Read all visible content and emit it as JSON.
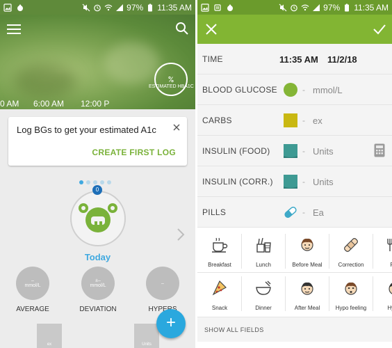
{
  "left": {
    "status": {
      "battery": "97%",
      "time": "11:35 AM"
    },
    "chart_axis": [
      "0 AM",
      "6:00 AM",
      "12:00 P"
    ],
    "estimated_label": "ESTIMATED HBA1C",
    "log_card": {
      "message": "Log BGs to get your estimated A1c",
      "cta": "CREATE FIRST LOG"
    },
    "badge": "0",
    "day_label": "Today",
    "stats": [
      {
        "unit": "mmol/L",
        "label": "AVERAGE"
      },
      {
        "unit": "mmol/L",
        "label": "DEVIATION"
      },
      {
        "unit": "",
        "label": "HYPERS"
      }
    ],
    "sub_squares": [
      "ex",
      "Units"
    ]
  },
  "right": {
    "status": {
      "battery": "97%",
      "time": "11:35 AM"
    },
    "time_row": {
      "label": "TIME",
      "time": "11:35 AM",
      "date": "11/2/18"
    },
    "fields": [
      {
        "label": "BLOOD GLUCOSE",
        "dash": "-",
        "unit": "mmol/L",
        "color": "#84b536"
      },
      {
        "label": "CARBS",
        "dash": "-",
        "unit": "ex",
        "color": "#c9b812"
      },
      {
        "label": "INSULIN (FOOD)",
        "dash": "-",
        "unit": "Units",
        "color": "#3e9a93"
      },
      {
        "label": "INSULIN (CORR.)",
        "dash": "-",
        "unit": "Units",
        "color": "#3e9a93"
      },
      {
        "label": "PILLS",
        "dash": "-",
        "unit": "Ea",
        "color": "#3ea9c8"
      }
    ],
    "tags_row1": [
      "Breakfast",
      "Lunch",
      "Before Meal",
      "Correction",
      "Fas"
    ],
    "tags_row2": [
      "Snack",
      "Dinner",
      "After Meal",
      "Hypo feeling",
      "Hyper"
    ],
    "show_all": "SHOW ALL FIELDS"
  }
}
